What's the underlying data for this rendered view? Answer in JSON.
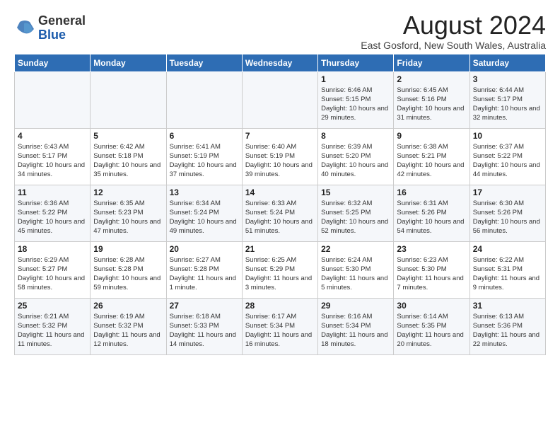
{
  "logo": {
    "general": "General",
    "blue": "Blue"
  },
  "title": "August 2024",
  "location": "East Gosford, New South Wales, Australia",
  "weekdays": [
    "Sunday",
    "Monday",
    "Tuesday",
    "Wednesday",
    "Thursday",
    "Friday",
    "Saturday"
  ],
  "weeks": [
    [
      {
        "day": "",
        "info": ""
      },
      {
        "day": "",
        "info": ""
      },
      {
        "day": "",
        "info": ""
      },
      {
        "day": "",
        "info": ""
      },
      {
        "day": "1",
        "info": "Sunrise: 6:46 AM\nSunset: 5:15 PM\nDaylight: 10 hours\nand 29 minutes."
      },
      {
        "day": "2",
        "info": "Sunrise: 6:45 AM\nSunset: 5:16 PM\nDaylight: 10 hours\nand 31 minutes."
      },
      {
        "day": "3",
        "info": "Sunrise: 6:44 AM\nSunset: 5:17 PM\nDaylight: 10 hours\nand 32 minutes."
      }
    ],
    [
      {
        "day": "4",
        "info": "Sunrise: 6:43 AM\nSunset: 5:17 PM\nDaylight: 10 hours\nand 34 minutes."
      },
      {
        "day": "5",
        "info": "Sunrise: 6:42 AM\nSunset: 5:18 PM\nDaylight: 10 hours\nand 35 minutes."
      },
      {
        "day": "6",
        "info": "Sunrise: 6:41 AM\nSunset: 5:19 PM\nDaylight: 10 hours\nand 37 minutes."
      },
      {
        "day": "7",
        "info": "Sunrise: 6:40 AM\nSunset: 5:19 PM\nDaylight: 10 hours\nand 39 minutes."
      },
      {
        "day": "8",
        "info": "Sunrise: 6:39 AM\nSunset: 5:20 PM\nDaylight: 10 hours\nand 40 minutes."
      },
      {
        "day": "9",
        "info": "Sunrise: 6:38 AM\nSunset: 5:21 PM\nDaylight: 10 hours\nand 42 minutes."
      },
      {
        "day": "10",
        "info": "Sunrise: 6:37 AM\nSunset: 5:22 PM\nDaylight: 10 hours\nand 44 minutes."
      }
    ],
    [
      {
        "day": "11",
        "info": "Sunrise: 6:36 AM\nSunset: 5:22 PM\nDaylight: 10 hours\nand 45 minutes."
      },
      {
        "day": "12",
        "info": "Sunrise: 6:35 AM\nSunset: 5:23 PM\nDaylight: 10 hours\nand 47 minutes."
      },
      {
        "day": "13",
        "info": "Sunrise: 6:34 AM\nSunset: 5:24 PM\nDaylight: 10 hours\nand 49 minutes."
      },
      {
        "day": "14",
        "info": "Sunrise: 6:33 AM\nSunset: 5:24 PM\nDaylight: 10 hours\nand 51 minutes."
      },
      {
        "day": "15",
        "info": "Sunrise: 6:32 AM\nSunset: 5:25 PM\nDaylight: 10 hours\nand 52 minutes."
      },
      {
        "day": "16",
        "info": "Sunrise: 6:31 AM\nSunset: 5:26 PM\nDaylight: 10 hours\nand 54 minutes."
      },
      {
        "day": "17",
        "info": "Sunrise: 6:30 AM\nSunset: 5:26 PM\nDaylight: 10 hours\nand 56 minutes."
      }
    ],
    [
      {
        "day": "18",
        "info": "Sunrise: 6:29 AM\nSunset: 5:27 PM\nDaylight: 10 hours\nand 58 minutes."
      },
      {
        "day": "19",
        "info": "Sunrise: 6:28 AM\nSunset: 5:28 PM\nDaylight: 10 hours\nand 59 minutes."
      },
      {
        "day": "20",
        "info": "Sunrise: 6:27 AM\nSunset: 5:28 PM\nDaylight: 11 hours\nand 1 minute."
      },
      {
        "day": "21",
        "info": "Sunrise: 6:25 AM\nSunset: 5:29 PM\nDaylight: 11 hours\nand 3 minutes."
      },
      {
        "day": "22",
        "info": "Sunrise: 6:24 AM\nSunset: 5:30 PM\nDaylight: 11 hours\nand 5 minutes."
      },
      {
        "day": "23",
        "info": "Sunrise: 6:23 AM\nSunset: 5:30 PM\nDaylight: 11 hours\nand 7 minutes."
      },
      {
        "day": "24",
        "info": "Sunrise: 6:22 AM\nSunset: 5:31 PM\nDaylight: 11 hours\nand 9 minutes."
      }
    ],
    [
      {
        "day": "25",
        "info": "Sunrise: 6:21 AM\nSunset: 5:32 PM\nDaylight: 11 hours\nand 11 minutes."
      },
      {
        "day": "26",
        "info": "Sunrise: 6:19 AM\nSunset: 5:32 PM\nDaylight: 11 hours\nand 12 minutes."
      },
      {
        "day": "27",
        "info": "Sunrise: 6:18 AM\nSunset: 5:33 PM\nDaylight: 11 hours\nand 14 minutes."
      },
      {
        "day": "28",
        "info": "Sunrise: 6:17 AM\nSunset: 5:34 PM\nDaylight: 11 hours\nand 16 minutes."
      },
      {
        "day": "29",
        "info": "Sunrise: 6:16 AM\nSunset: 5:34 PM\nDaylight: 11 hours\nand 18 minutes."
      },
      {
        "day": "30",
        "info": "Sunrise: 6:14 AM\nSunset: 5:35 PM\nDaylight: 11 hours\nand 20 minutes."
      },
      {
        "day": "31",
        "info": "Sunrise: 6:13 AM\nSunset: 5:36 PM\nDaylight: 11 hours\nand 22 minutes."
      }
    ]
  ]
}
